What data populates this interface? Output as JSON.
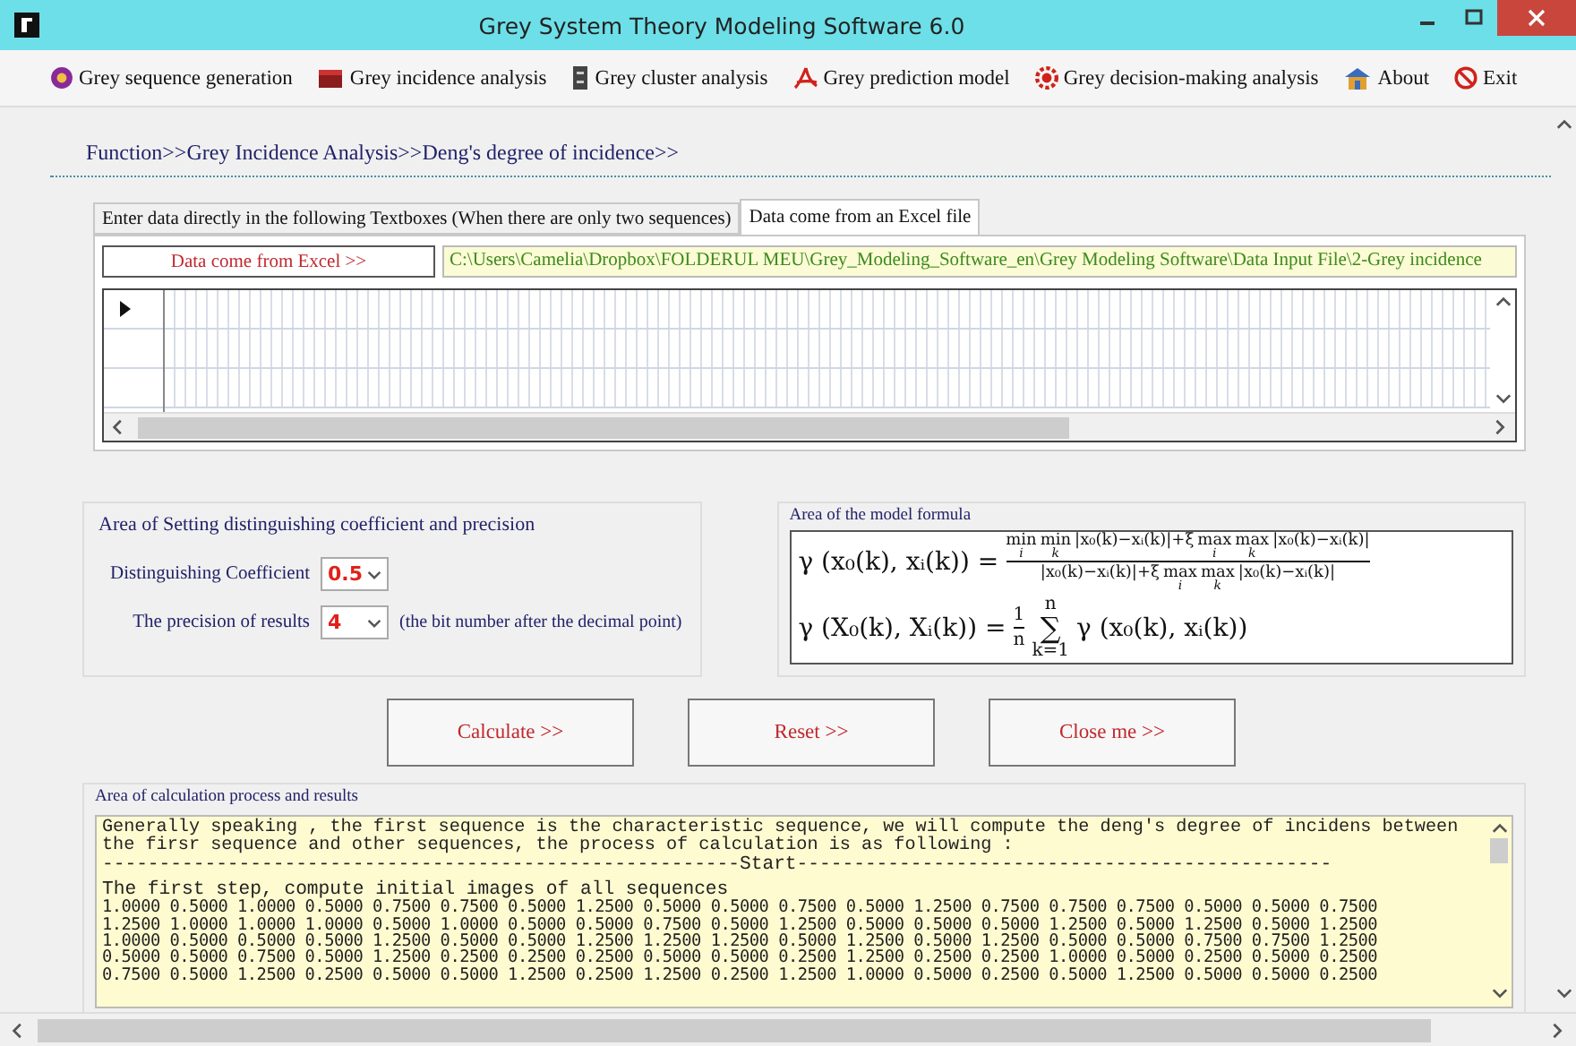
{
  "window": {
    "title": "Grey System Theory Modeling Software 6.0"
  },
  "menu": [
    {
      "label": "Grey sequence generation",
      "kind": "sequence"
    },
    {
      "label": "Grey incidence analysis",
      "kind": "incidence"
    },
    {
      "label": "Grey cluster analysis",
      "kind": "cluster"
    },
    {
      "label": "Grey prediction model",
      "kind": "prediction"
    },
    {
      "label": "Grey decision-making analysis",
      "kind": "decision"
    },
    {
      "label": "About",
      "kind": "about"
    },
    {
      "label": "Exit",
      "kind": "exit"
    }
  ],
  "breadcrumb": "Function>>Grey Incidence Analysis>>Deng's degree of incidence>>",
  "tabs": [
    {
      "label": "Enter data directly in the following Textboxes (When there are only two sequences)",
      "selected": false
    },
    {
      "label": "Data come from an Excel file",
      "selected": true
    }
  ],
  "excel": {
    "button": "Data come from Excel >>",
    "path": "C:\\Users\\Camelia\\Dropbox\\FOLDERUL MEU\\Grey_Modeling_Software_en\\Grey Modeling Software\\Data Input File\\2-Grey incidence"
  },
  "settings": {
    "title": "Area of  Setting distinguishing coefficient and precision",
    "fields": [
      {
        "label": "Distinguishing Coefficient",
        "value": "0.5"
      },
      {
        "label": "The precision of results",
        "value": "4",
        "note": "(the bit number after the decimal point)"
      }
    ]
  },
  "formula": {
    "title": "Area of the model formula",
    "line1": {
      "lhs": "γ (x₀(k), xᵢ(k)) =",
      "numerator": [
        {
          "kind": "op",
          "text": "min",
          "sub": "i"
        },
        {
          "kind": "op",
          "text": "min",
          "sub": "k"
        },
        {
          "kind": "text",
          "text": "|x₀(k)−xᵢ(k)|+ξ"
        },
        {
          "kind": "op",
          "text": "max",
          "sub": "i"
        },
        {
          "kind": "op",
          "text": "max",
          "sub": "k"
        },
        {
          "kind": "text",
          "text": "|x₀(k)−xᵢ(k)|"
        }
      ],
      "denominator": [
        {
          "kind": "text",
          "text": "|x₀(k)−xᵢ(k)|+ξ"
        },
        {
          "kind": "op",
          "text": "max",
          "sub": "i"
        },
        {
          "kind": "op",
          "text": "max",
          "sub": "k"
        },
        {
          "kind": "text",
          "text": "|x₀(k)−xᵢ(k)|"
        }
      ]
    },
    "line2": {
      "lhs": "γ (X₀(k), Xᵢ(k)) =",
      "frac_num": "1",
      "frac_den": "n",
      "sum": "∑",
      "sum_upper": "n",
      "sum_lower": "k=1",
      "rhs": "γ (x₀(k), xᵢ(k))"
    }
  },
  "buttons": [
    "Calculate >>",
    "Reset >>",
    "Close me >>"
  ],
  "results": {
    "title": "Area of calculation process and results",
    "intro": "Generally speaking , the first sequence is the characteristic sequence, we will compute the deng's degree of incidens between the firsr sequence and other sequences, the process of calculation is as following :",
    "separator": "--------------------------------------------------------Start-----------------------------------------------",
    "step": "The first step, compute initial images of all sequences",
    "rows": [
      "1.0000 0.5000 1.0000 0.5000 0.7500 0.7500 0.5000 1.2500 0.5000 0.5000 0.7500 0.5000 1.2500 0.7500 0.7500 0.7500 0.5000 0.5000 0.7500",
      "1.2500 1.0000 1.0000 1.0000 0.5000 1.0000 0.5000 0.5000 0.7500 0.5000 1.2500 0.5000 0.5000 0.5000 1.2500 0.5000 1.2500 0.5000 1.2500",
      "1.0000 0.5000 0.5000 0.5000 1.2500 0.5000 0.5000 1.2500 1.2500 1.2500 0.5000 1.2500 0.5000 1.2500 0.5000 0.5000 0.7500 0.7500 1.2500",
      "0.5000 0.5000 0.7500 0.5000 1.2500 0.2500 0.2500 0.2500 0.5000 0.5000 0.2500 1.2500 0.2500 0.2500 1.0000 0.5000 0.2500 0.5000 0.2500",
      "0.7500 0.5000 1.2500 0.2500 0.5000 0.5000 1.2500 0.2500 1.2500 0.2500 1.2500 1.0000 0.5000 0.2500 0.5000 1.2500 0.5000 0.5000 0.2500"
    ]
  }
}
